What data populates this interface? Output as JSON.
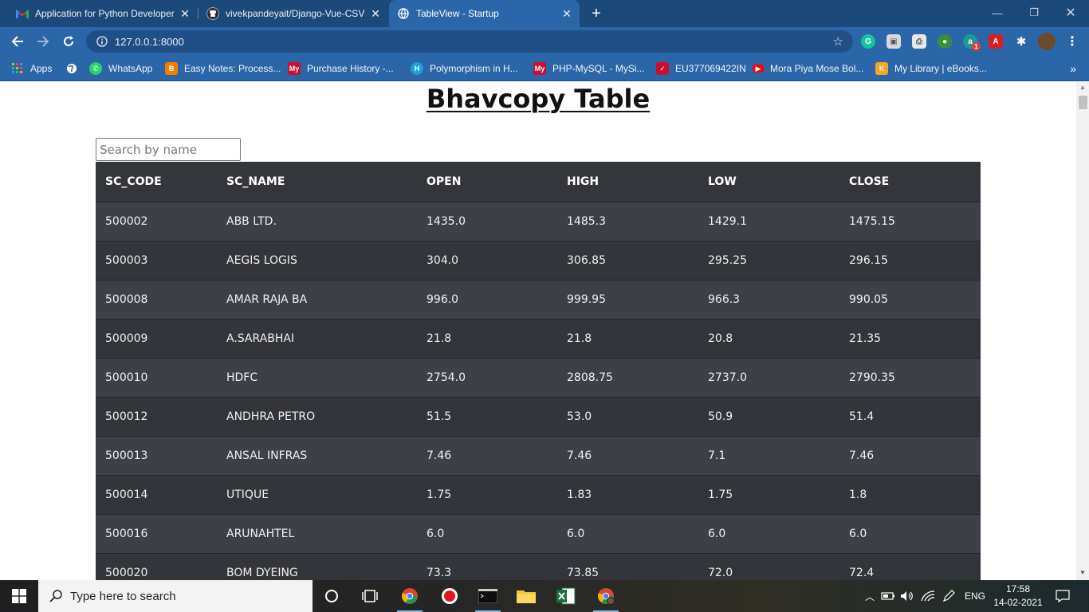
{
  "browser": {
    "tabs": [
      {
        "title": "Application for Python Developer",
        "icon": "gmail-icon"
      },
      {
        "title": "vivekpandeyait/Django-Vue-CSV",
        "icon": "github-icon"
      },
      {
        "title": "TableView - Startup",
        "icon": "globe-icon"
      }
    ],
    "url": "127.0.0.1:8000",
    "bookmarks": [
      {
        "label": "Apps",
        "icon": "apps-grid-icon"
      },
      {
        "label": "",
        "icon": "globe-icon"
      },
      {
        "label": "WhatsApp",
        "icon": "whatsapp-icon"
      },
      {
        "label": "Easy Notes: Process...",
        "icon": "blogger-icon"
      },
      {
        "label": "Purchase History -...",
        "icon": "my-icon"
      },
      {
        "label": "Polymorphism in H...",
        "icon": "hackerrank-icon"
      },
      {
        "label": "PHP-MySQL - MySi...",
        "icon": "my-icon"
      },
      {
        "label": "EU377069422IN",
        "icon": "checkmark-icon"
      },
      {
        "label": "Mora Piya Mose Bol...",
        "icon": "youtube-icon"
      },
      {
        "label": "My Library | eBooks...",
        "icon": "kindle-icon"
      }
    ],
    "extension_badge": "1"
  },
  "page": {
    "title": "Bhavcopy Table",
    "search_placeholder": "Search by name",
    "table": {
      "headers": [
        "SC_CODE",
        "SC_NAME",
        "OPEN",
        "HIGH",
        "LOW",
        "CLOSE"
      ],
      "rows": [
        [
          "500002",
          "ABB LTD.",
          "1435.0",
          "1485.3",
          "1429.1",
          "1475.15"
        ],
        [
          "500003",
          "AEGIS LOGIS",
          "304.0",
          "306.85",
          "295.25",
          "296.15"
        ],
        [
          "500008",
          "AMAR RAJA BA",
          "996.0",
          "999.95",
          "966.3",
          "990.05"
        ],
        [
          "500009",
          "A.SARABHAI",
          "21.8",
          "21.8",
          "20.8",
          "21.35"
        ],
        [
          "500010",
          "HDFC",
          "2754.0",
          "2808.75",
          "2737.0",
          "2790.35"
        ],
        [
          "500012",
          "ANDHRA PETRO",
          "51.5",
          "53.0",
          "50.9",
          "51.4"
        ],
        [
          "500013",
          "ANSAL INFRAS",
          "7.46",
          "7.46",
          "7.1",
          "7.46"
        ],
        [
          "500014",
          "UTIQUE",
          "1.75",
          "1.83",
          "1.75",
          "1.8"
        ],
        [
          "500016",
          "ARUNAHTEL",
          "6.0",
          "6.0",
          "6.0",
          "6.0"
        ],
        [
          "500020",
          "BOM DYEING",
          "73.3",
          "73.85",
          "72.0",
          "72.4"
        ]
      ]
    }
  },
  "taskbar": {
    "search_placeholder": "Type here to search",
    "language": "ENG",
    "time": "17:58",
    "date": "14-02-2021"
  }
}
